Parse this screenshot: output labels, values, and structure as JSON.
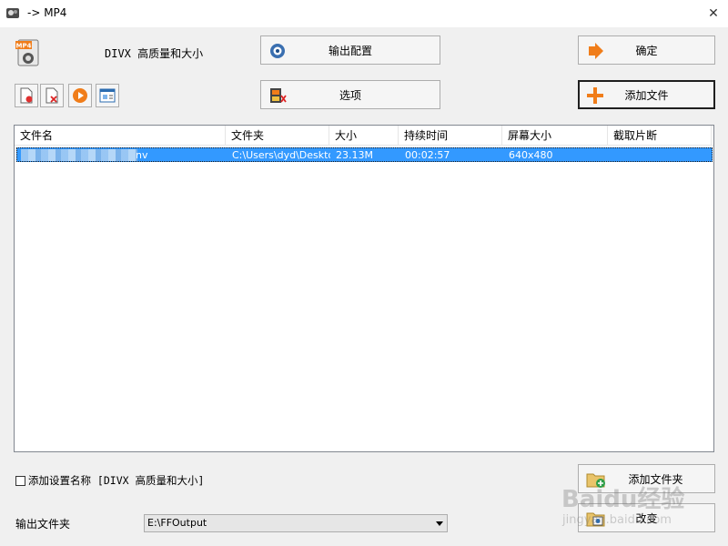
{
  "window": {
    "title": "-> MP4",
    "close_glyph": "✕"
  },
  "profile": {
    "name": "DIVX 高质量和大小",
    "icon_badge": "MP4"
  },
  "buttons": {
    "output_config": "输出配置",
    "options": "选项",
    "ok": "确定",
    "add_file": "添加文件",
    "add_folder": "添加文件夹",
    "change": "改变"
  },
  "list": {
    "columns": [
      "文件名",
      "文件夹",
      "大小",
      "持续时间",
      "屏幕大小",
      "截取片断"
    ],
    "rows": [
      {
        "filename_suffix": "nv",
        "folder": "C:\\Users\\dyd\\Desktop",
        "size": "23.13M",
        "duration": "00:02:57",
        "screen_size": "640x480",
        "clip": ""
      }
    ]
  },
  "footer": {
    "checkbox_label": "添加设置名称 [DIVX 高质量和大小]",
    "output_folder_label": "输出文件夹",
    "output_folder_value": "E:\\FFOutput"
  },
  "watermark": {
    "line1": "Baidu经验",
    "line2": "jingyan.baidu.com"
  },
  "colors": {
    "selection": "#3399ff",
    "accent_orange": "#f07d1a"
  },
  "icons": [
    "app-icon",
    "mp4-file-icon",
    "output-config-icon",
    "options-film-icon",
    "ok-arrow-icon",
    "add-plus-icon",
    "add-folder-icon",
    "change-folder-icon",
    "new-file-icon",
    "remove-file-icon",
    "play-icon",
    "info-window-icon"
  ]
}
